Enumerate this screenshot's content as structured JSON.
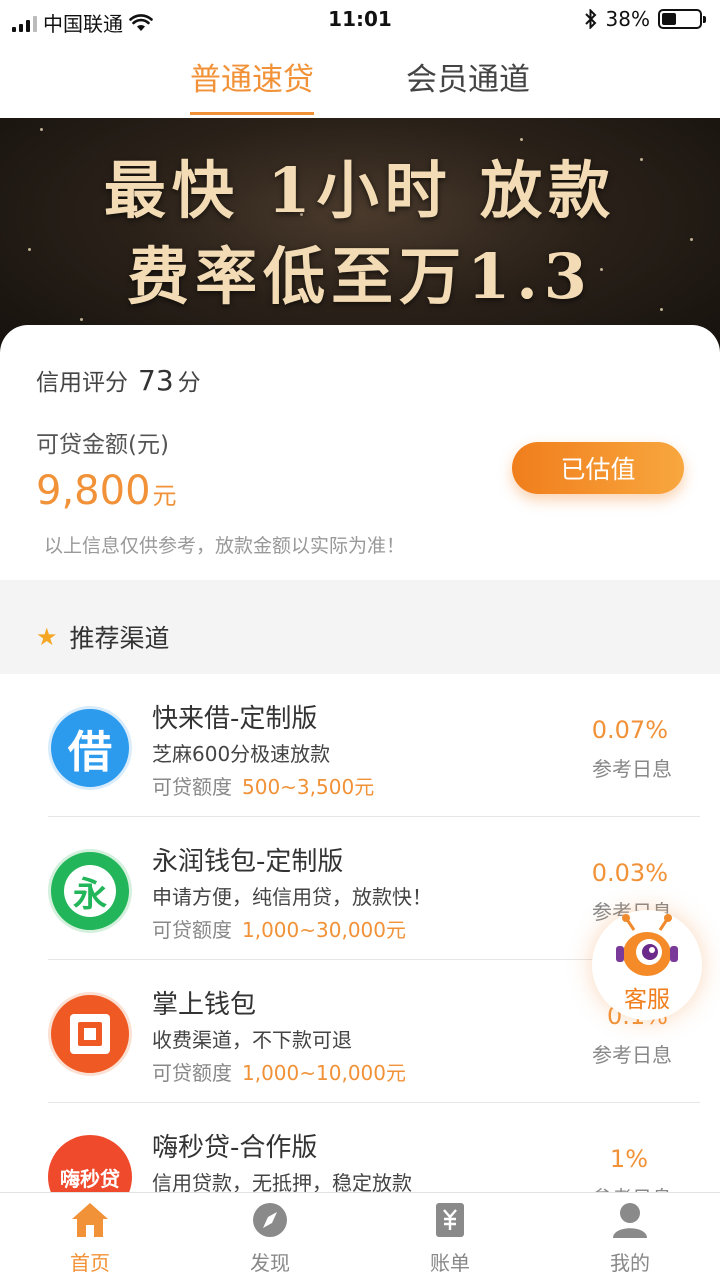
{
  "status_bar": {
    "carrier": "中国联通",
    "time": "11:01",
    "battery": "38%",
    "battery_level": 0.38
  },
  "top_tabs": [
    {
      "label": "普通速贷",
      "active": true
    },
    {
      "label": "会员通道",
      "active": false
    }
  ],
  "banner": {
    "line1": "最快 1小时 放款",
    "line2": "费率低至万1.3"
  },
  "credit": {
    "score_label": "信用评分",
    "score_value": "73",
    "score_unit": "分",
    "amount_label": "可贷金额(元)",
    "amount_value": "9,800",
    "amount_unit": "元",
    "button_label": "已估值",
    "disclaimer": "以上信息仅供参考，放款金额以实际为准！"
  },
  "section": {
    "title": "推荐渠道"
  },
  "range_label": "可贷额度",
  "rate_label": "参考日息",
  "items": [
    {
      "name": "快来借-定制版",
      "desc": "芝麻600分极速放款",
      "range": "500~3,500元",
      "rate": "0.07%",
      "logo_text": "借",
      "logo_color": "#2c9bee",
      "icon": "jie-logo-icon"
    },
    {
      "name": "永润钱包-定制版",
      "desc": "申请方便，纯信用贷，放款快！",
      "range": "1,000~30,000元",
      "rate": "0.03%",
      "logo_text": "永",
      "logo_color": "#22b55a",
      "icon": "yong-logo-icon"
    },
    {
      "name": "掌上钱包",
      "desc": "收费渠道，不下款可退",
      "range": "1,000~10,000元",
      "rate": "0.1%",
      "logo_text": "",
      "logo_color": "#ef5a24",
      "icon": "wallet-logo-icon"
    },
    {
      "name": "嗨秒贷-合作版",
      "desc": "信用贷款，无抵押，稳定放款",
      "range": "",
      "rate": "1%",
      "logo_text": "嗨秒贷",
      "logo_color": "#ef4a2c",
      "icon": "haimiao-logo-icon"
    }
  ],
  "service": {
    "label": "客服",
    "icon": "robot-mascot-icon"
  },
  "bottom_nav": [
    {
      "label": "首页",
      "icon": "home-icon",
      "active": true
    },
    {
      "label": "发现",
      "icon": "compass-icon",
      "active": false
    },
    {
      "label": "账单",
      "icon": "bill-icon",
      "active": false
    },
    {
      "label": "我的",
      "icon": "user-icon",
      "active": false
    }
  ],
  "colors": {
    "accent": "#f19238",
    "button_gradient_start": "#f07e1c",
    "button_gradient_end": "#f8a73f",
    "banner_text": "#f3dcb5"
  }
}
